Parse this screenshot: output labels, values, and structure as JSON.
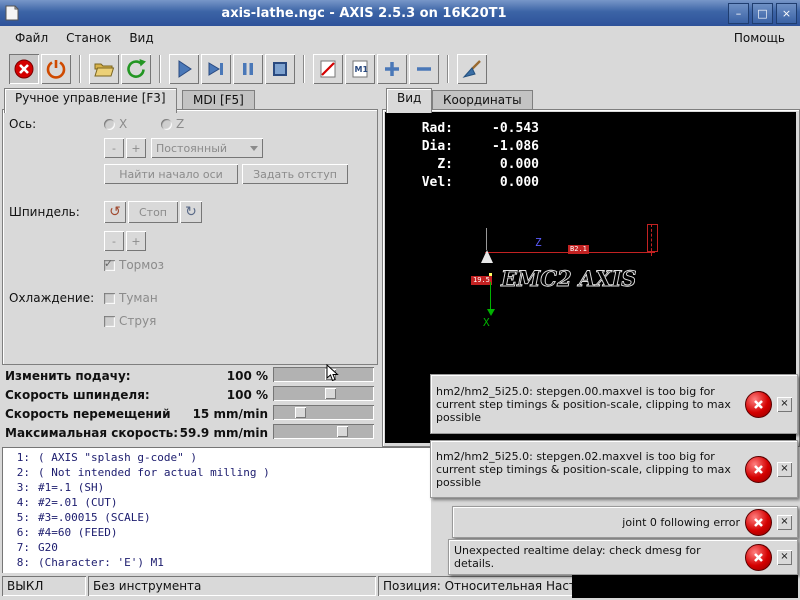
{
  "window": {
    "title": "axis-lathe.ngc - AXIS 2.5.3 on 16K20T1",
    "minimize_glyph": "–",
    "maximize_glyph": "□",
    "close_glyph": "×"
  },
  "menu": {
    "items": [
      "Файл",
      "Станок",
      "Вид"
    ],
    "help": "Помощь"
  },
  "toolbar": {
    "icons": [
      "estop",
      "machine-power",
      "open-file",
      "reload",
      "run",
      "step",
      "pause",
      "stop",
      "block-delete-slash",
      "optional-pause-m1",
      "zoom-in",
      "zoom-out",
      "clear-plot-broom"
    ],
    "m1_label": "M1"
  },
  "left_tabs": {
    "manual": "Ручное управление [F3]",
    "mdi": "MDI [F5]"
  },
  "manual": {
    "axis_label": "Ось:",
    "axis_x": "X",
    "axis_z": "Z",
    "minus": "-",
    "plus": "+",
    "jog_mode": "Постоянный",
    "home_axis": "Найти начало оси",
    "set_offset": "Задать отступ",
    "spindle_label": "Шпиндель:",
    "spindle_ccw_glyph": "↺",
    "spindle_cw_glyph": "↻",
    "spindle_stop": "Стоп",
    "brake": "Тормоз",
    "coolant_label": "Охлаждение:",
    "mist": "Туман",
    "flood": "Струя"
  },
  "overrides": {
    "feed": {
      "label": "Изменить подачу:",
      "value": "100 %"
    },
    "spindle": {
      "label": "Скорость шпинделя:",
      "value": "100 %"
    },
    "jog": {
      "label": "Скорость перемещений",
      "value": "15 mm/min"
    },
    "maxvel": {
      "label": "Максимальная скорость:",
      "value": "59.9 mm/min"
    }
  },
  "right_tabs": {
    "preview": "Вид",
    "dro": "Координаты"
  },
  "dro": {
    "rows": [
      {
        "label": "Rad:",
        "value": "-0.543"
      },
      {
        "label": "Dia:",
        "value": "-1.086"
      },
      {
        "label": "Z:",
        "value": "0.000"
      },
      {
        "label": "Vel:",
        "value": "0.000"
      }
    ]
  },
  "preview": {
    "logo": "EMC2 AXIS",
    "z_label": "Z",
    "x_label": "X",
    "dim1": "B2.1",
    "dim2": "19.5"
  },
  "gcode": {
    "lines": [
      {
        "n": "1:",
        "t": "( AXIS \"splash g-code\" )"
      },
      {
        "n": "2:",
        "t": "( Not intended for actual milling )"
      },
      {
        "n": "3:",
        "t": "#1=.1 (SH)"
      },
      {
        "n": "4:",
        "t": "#2=.01 (CUT)"
      },
      {
        "n": "5:",
        "t": "#3=.00015 (SCALE)"
      },
      {
        "n": "6:",
        "t": "#4=60 (FEED)"
      },
      {
        "n": "7:",
        "t": "G20"
      },
      {
        "n": "8:",
        "t": "(Character: 'E') M1"
      }
    ]
  },
  "errors": [
    {
      "text": "hm2/hm2_5i25.0: stepgen.00.maxvel is too big for current step timings & position-scale, clipping to max possible"
    },
    {
      "text": "hm2/hm2_5i25.0: stepgen.02.maxvel is too big for current step timings & position-scale, clipping to max possible"
    },
    {
      "text": "joint 0 following error"
    },
    {
      "text": "Unexpected realtime delay: check dmesg for details."
    }
  ],
  "status": {
    "machine": "ВЫКЛ",
    "tool": "Без инструмента",
    "position": "Позиция: Относительная Насто"
  },
  "colors": {
    "titlebar": "#3c64a6",
    "error_red": "#cc0000",
    "accent_blue": "#4a78b8",
    "preview_red": "#c22222"
  }
}
